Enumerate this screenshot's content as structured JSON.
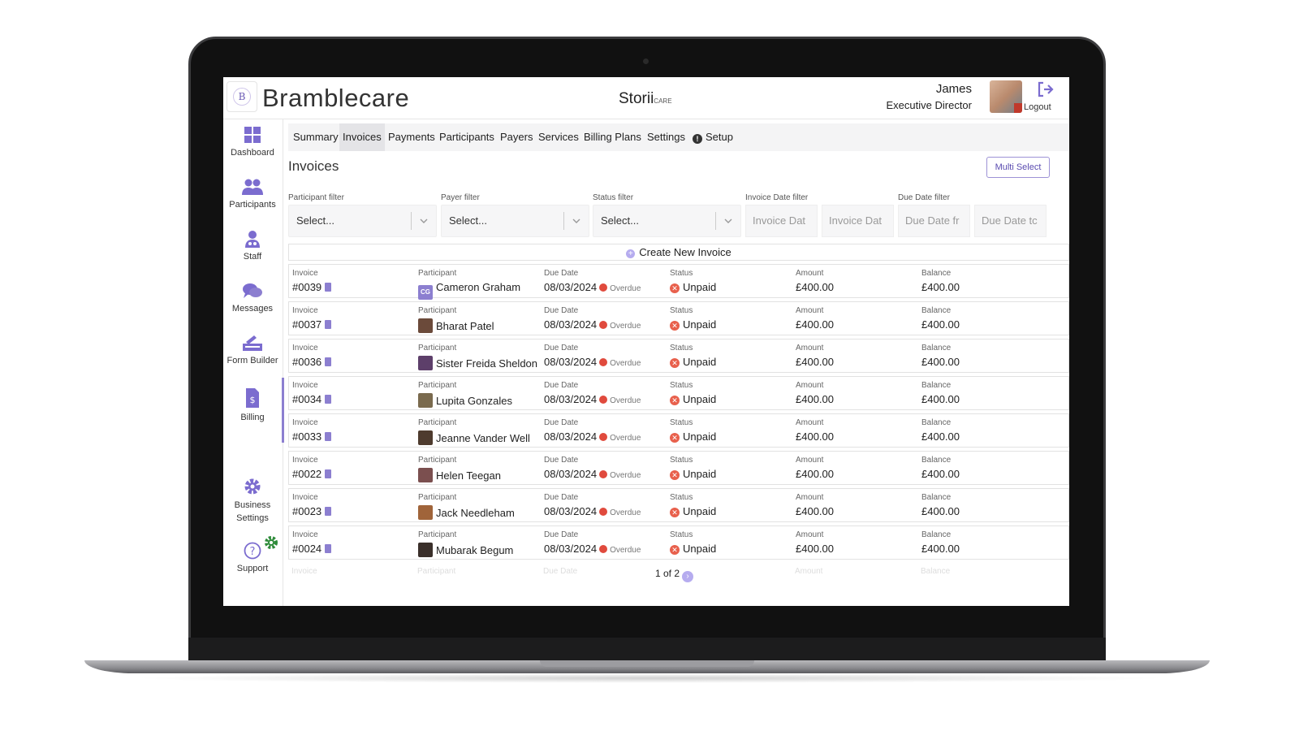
{
  "app": {
    "brand": "Bramblecare",
    "logo_mark": "B",
    "partner": "Storii",
    "partner_suffix": "CARE",
    "user_name": "James",
    "user_role": "Executive Director",
    "logout_label": "Logout"
  },
  "sidebar": {
    "items": [
      {
        "label": "Dashboard",
        "icon": "dashboard-icon"
      },
      {
        "label": "Participants",
        "icon": "participants-icon"
      },
      {
        "label": "Staff",
        "icon": "staff-icon"
      },
      {
        "label": "Messages",
        "icon": "messages-icon"
      },
      {
        "label": "Form Builder",
        "icon": "form-builder-icon"
      },
      {
        "label": "Billing",
        "icon": "billing-icon"
      }
    ],
    "business_settings_line1": "Business",
    "business_settings_line2": "Settings",
    "support_label": "Support",
    "active": "Billing"
  },
  "tabs": [
    "Summary",
    "Invoices",
    "Payments",
    "Participants",
    "Payers",
    "Services",
    "Billing Plans",
    "Settings",
    "Setup"
  ],
  "active_tab": "Invoices",
  "page": {
    "title": "Invoices",
    "multi_select_label": "Multi Select",
    "create_label": "Create New Invoice"
  },
  "filters": {
    "participant_label": "Participant filter",
    "participant_placeholder": "Select...",
    "payer_label": "Payer filter",
    "payer_placeholder": "Select...",
    "status_label": "Status filter",
    "status_placeholder": "Select...",
    "invoice_date_label": "Invoice Date filter",
    "invoice_date_from": "Invoice Dat",
    "invoice_date_to": "Invoice Dat",
    "due_date_label": "Due Date filter",
    "due_date_from": "Due Date fr",
    "due_date_to": "Due Date tc"
  },
  "columns": {
    "invoice": "Invoice",
    "participant": "Participant",
    "due_date": "Due Date",
    "status": "Status",
    "amount": "Amount",
    "balance": "Balance"
  },
  "invoices": [
    {
      "number": "#0039",
      "participant": "Cameron Graham",
      "initials": "CG",
      "avatar_color": "#8c7fd0",
      "due_date": "08/03/2024",
      "overdue": "Overdue",
      "status": "Unpaid",
      "amount": "£400.00",
      "balance": "£400.00"
    },
    {
      "number": "#0037",
      "participant": "Bharat Patel",
      "initials": "",
      "avatar_color": "#6b4a3a",
      "due_date": "08/03/2024",
      "overdue": "Overdue",
      "status": "Unpaid",
      "amount": "£400.00",
      "balance": "£400.00"
    },
    {
      "number": "#0036",
      "participant": "Sister Freida Sheldon",
      "initials": "",
      "avatar_color": "#5d3f6a",
      "due_date": "08/03/2024",
      "overdue": "Overdue",
      "status": "Unpaid",
      "amount": "£400.00",
      "balance": "£400.00"
    },
    {
      "number": "#0034",
      "participant": "Lupita Gonzales",
      "initials": "",
      "avatar_color": "#7a6a4e",
      "due_date": "08/03/2024",
      "overdue": "Overdue",
      "status": "Unpaid",
      "amount": "£400.00",
      "balance": "£400.00"
    },
    {
      "number": "#0033",
      "participant": "Jeanne Vander Well",
      "initials": "",
      "avatar_color": "#4e3b2e",
      "due_date": "08/03/2024",
      "overdue": "Overdue",
      "status": "Unpaid",
      "amount": "£400.00",
      "balance": "£400.00"
    },
    {
      "number": "#0022",
      "participant": "Helen Teegan",
      "initials": "",
      "avatar_color": "#7b4f4f",
      "due_date": "08/03/2024",
      "overdue": "Overdue",
      "status": "Unpaid",
      "amount": "£400.00",
      "balance": "£400.00"
    },
    {
      "number": "#0023",
      "participant": "Jack Needleham",
      "initials": "",
      "avatar_color": "#a0643a",
      "due_date": "08/03/2024",
      "overdue": "Overdue",
      "status": "Unpaid",
      "amount": "£400.00",
      "balance": "£400.00"
    },
    {
      "number": "#0024",
      "participant": "Mubarak Begum",
      "initials": "",
      "avatar_color": "#3a2f2a",
      "due_date": "08/03/2024",
      "overdue": "Overdue",
      "status": "Unpaid",
      "amount": "£400.00",
      "balance": "£400.00"
    }
  ],
  "pagination": {
    "text": "1 of 2",
    "next": "›"
  },
  "colors": {
    "accent": "#8c7fd0",
    "unpaid": "#e8604c",
    "overdue": "#e04a3d"
  }
}
